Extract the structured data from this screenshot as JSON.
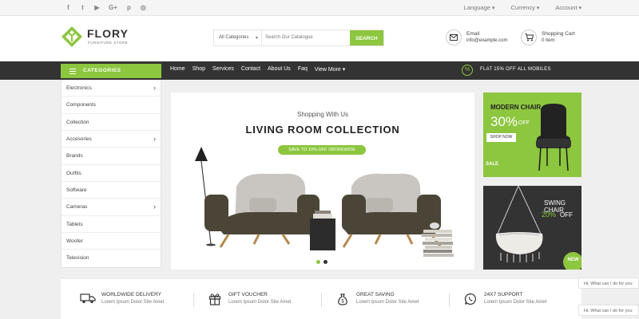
{
  "topbar": {
    "social_icons": [
      {
        "icon": "facebook-icon",
        "glyph": "f"
      },
      {
        "icon": "twitter-icon",
        "glyph": "t"
      },
      {
        "icon": "youtube-icon",
        "glyph": "▶"
      },
      {
        "icon": "google-plus-icon",
        "glyph": "G+"
      },
      {
        "icon": "pinterest-icon",
        "glyph": "p"
      },
      {
        "icon": "instagram-icon",
        "glyph": "◎"
      }
    ],
    "language": "Language",
    "currency": "Currency",
    "account": "Account"
  },
  "header": {
    "logo_name": "FLORY",
    "logo_tagline": "FURNITURE STORE",
    "search": {
      "category": "All Categories",
      "placeholder": "Search Our Catalogue",
      "button": "SEARCH"
    },
    "email": {
      "label": "Email",
      "value": "info@example.com"
    },
    "cart": {
      "label": "Shopping Cart",
      "count": "0 item"
    }
  },
  "nav": {
    "categories_label": "CATEGORIES",
    "menu": [
      "Home",
      "Shop",
      "Services",
      "Contact",
      "About Us",
      "Faq",
      "View More"
    ],
    "promo": "FLAT 15% OFF ALL MOBILES"
  },
  "sidebar": {
    "items": [
      {
        "label": "Electronics",
        "has_sub": true
      },
      {
        "label": "Components",
        "has_sub": false
      },
      {
        "label": "Collection",
        "has_sub": false
      },
      {
        "label": "Accesories",
        "has_sub": true
      },
      {
        "label": "Brands",
        "has_sub": false
      },
      {
        "label": "Outfits",
        "has_sub": false
      },
      {
        "label": "Software",
        "has_sub": false
      },
      {
        "label": "Cameras",
        "has_sub": true
      },
      {
        "label": "Tablets",
        "has_sub": false
      },
      {
        "label": "Woofer",
        "has_sub": false
      },
      {
        "label": "Television",
        "has_sub": false
      }
    ]
  },
  "hero": {
    "subtitle": "Shopping With Us",
    "title": "LIVING ROOM COLLECTION",
    "tag": "SAVE TO 10% OFF SROREWIDE",
    "slides": 2,
    "active_slide": 1
  },
  "banners": {
    "modern_chair": {
      "title": "MODERN CHAIR",
      "percent": "30%",
      "off": "OFF",
      "button": "SHOP NOW",
      "badge": "SALE"
    },
    "swing_chair": {
      "title": "SWING CHAIR",
      "percent": "20%",
      "off": "OFF",
      "badge": "NEW"
    }
  },
  "features": [
    {
      "icon": "truck-icon",
      "title": "WORLDWIDE DELIVERY",
      "desc": "Lorem Ipsum Dolor Site Amet"
    },
    {
      "icon": "gift-icon",
      "title": "GIFT VOUCHER",
      "desc": "Lorem Ipsum Dolor Site Amet"
    },
    {
      "icon": "money-bag-icon",
      "title": "GREAT SAVING",
      "desc": "Lorem Ipsum Dolor Site Amet"
    },
    {
      "icon": "whatsapp-icon",
      "title": "24X7 SUPPORT",
      "desc": "Lorem Ipsum Dolor Site Amet"
    }
  ],
  "chat": [
    "Hi, What can I do for you",
    "Hi, What can I do for you"
  ],
  "colors": {
    "accent": "#8dc63f",
    "dark": "#333333"
  }
}
